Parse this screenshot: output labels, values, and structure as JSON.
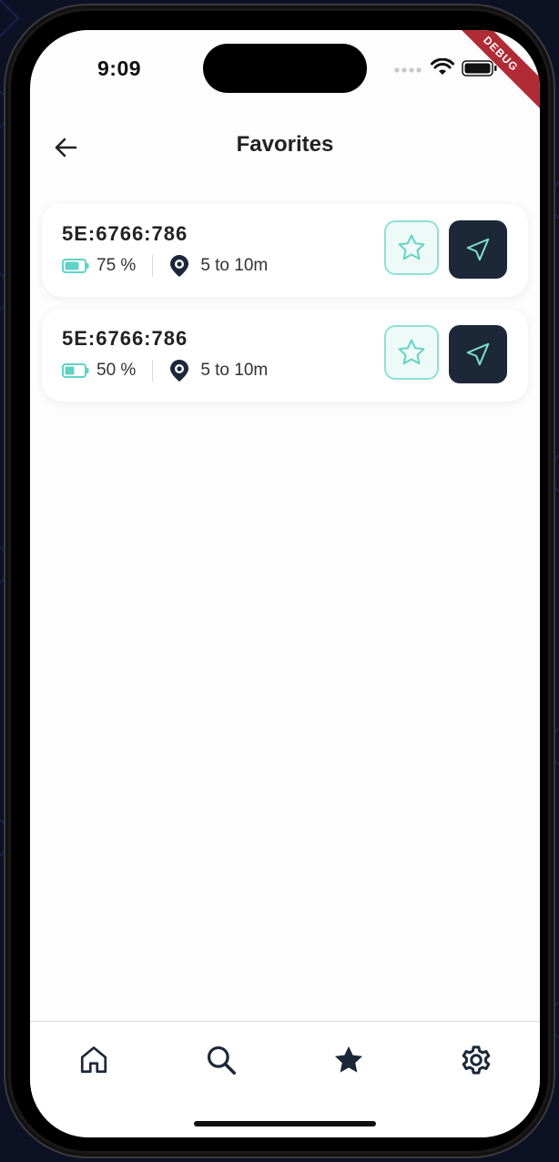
{
  "status_bar": {
    "time": "9:09",
    "debug_label": "DEBUG"
  },
  "header": {
    "title": "Favorites",
    "back_icon": "arrow-left-icon"
  },
  "favorites": [
    {
      "id": "5E:6766:786",
      "battery": "75 %",
      "battery_level": 0.75,
      "distance": "5 to 10m"
    },
    {
      "id": "5E:6766:786",
      "battery": "50 %",
      "battery_level": 0.5,
      "distance": "5 to 10m"
    }
  ],
  "bottom_nav": {
    "items": [
      {
        "name": "home",
        "icon": "home-icon",
        "active": false
      },
      {
        "name": "search",
        "icon": "search-icon",
        "active": false
      },
      {
        "name": "favorites",
        "icon": "star-filled-icon",
        "active": true
      },
      {
        "name": "settings",
        "icon": "gear-icon",
        "active": false
      }
    ]
  },
  "colors": {
    "accent_teal": "#5fd3c4",
    "dark_navy": "#1c2838",
    "debug_red": "#b02b36"
  }
}
